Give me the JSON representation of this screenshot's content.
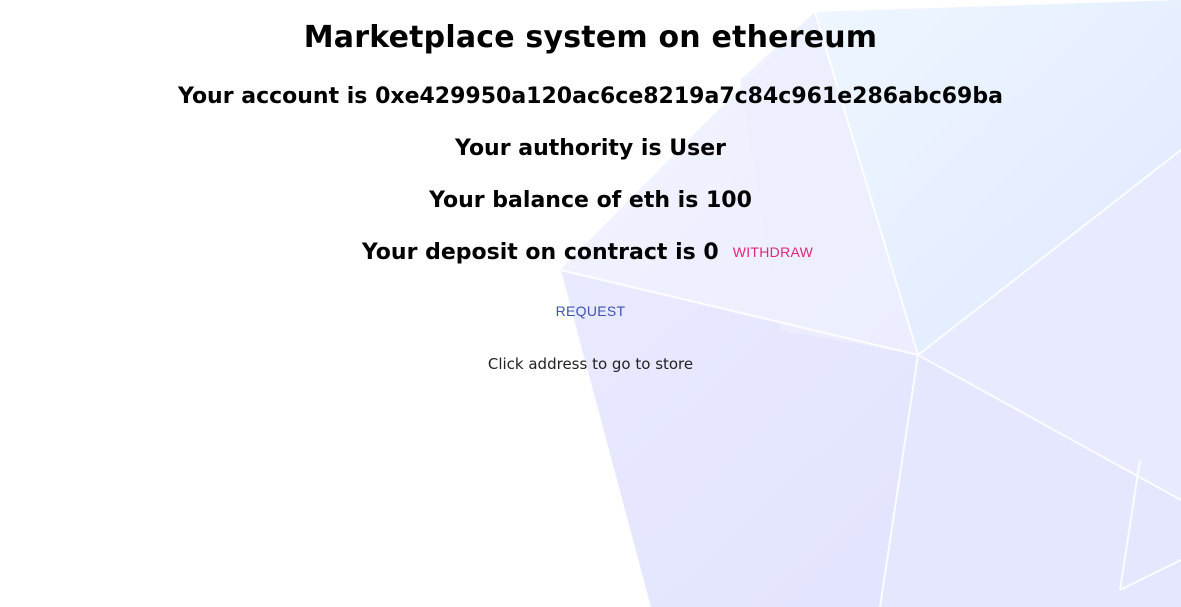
{
  "page": {
    "title": "Marketplace system on ethereum",
    "account_line": "Your account is 0xe429950a120ac6ce8219a7c84c961e286abc69ba",
    "authority_line": "Your authority is User",
    "balance_line": "Your balance of eth is 100",
    "deposit_line": "Your deposit on contract is 0",
    "withdraw_label": "WITHDRAW",
    "request_label": "REQUEST",
    "hint": "Click address to go to store"
  },
  "colors": {
    "withdraw": "#e0267a",
    "request": "#3f51b5",
    "background_shape": "#e3e4ff"
  }
}
